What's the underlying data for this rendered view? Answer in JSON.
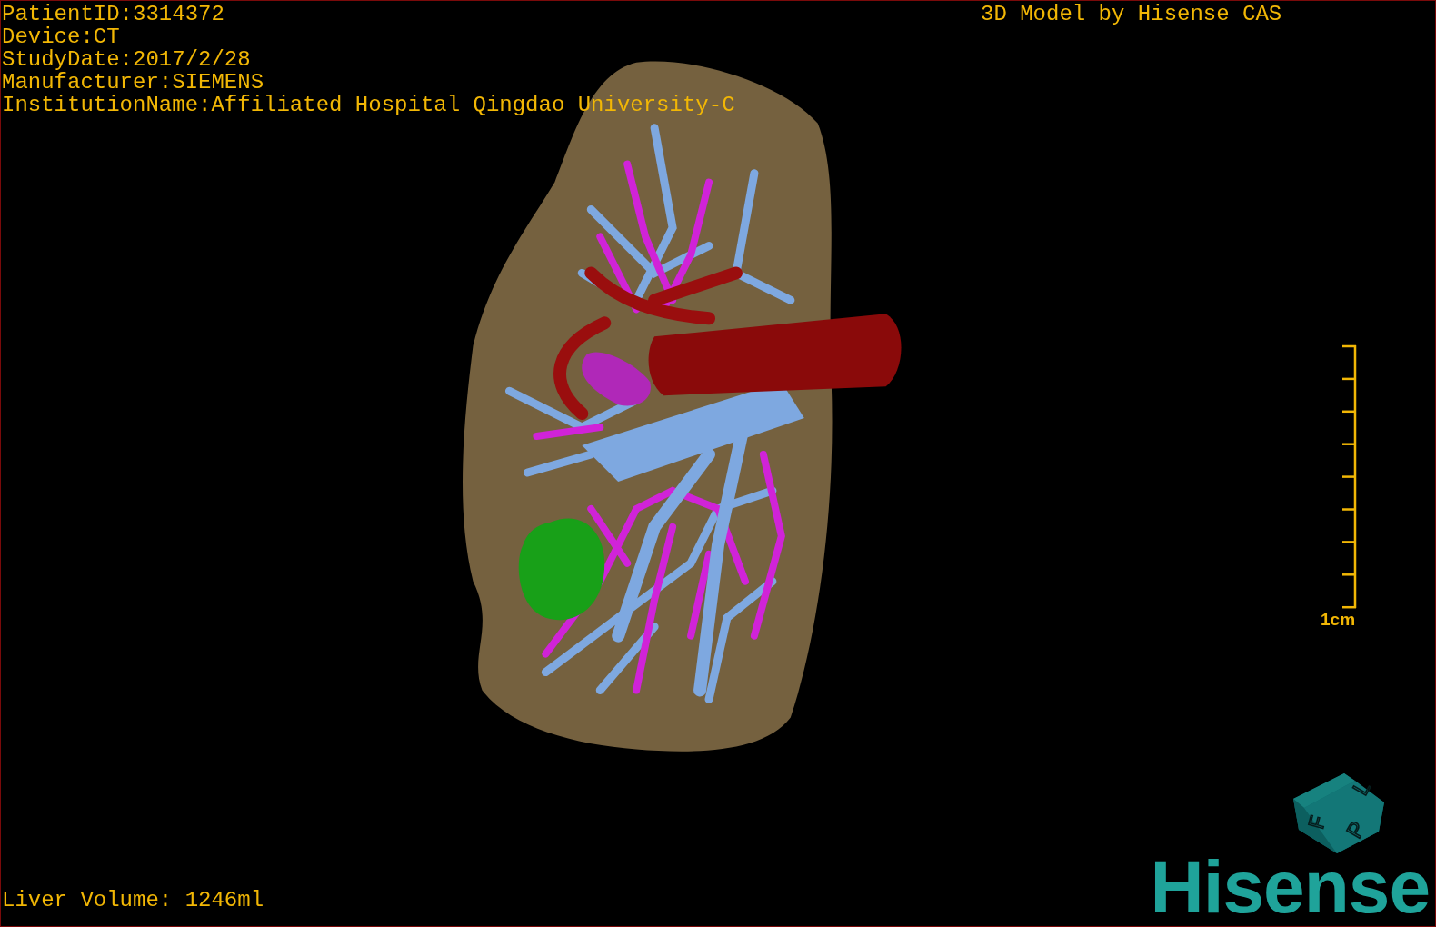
{
  "info_lines": [
    "PatientID:3314372",
    "Device:CT",
    "StudyDate:2017/2/28",
    "Manufacturer:SIEMENS",
    "InstitutionName:Affiliated Hospital Qingdao University-C"
  ],
  "credit": "3D Model by Hisense CAS",
  "scale_bar": {
    "label": "1cm"
  },
  "orientation_cube": {
    "faces": [
      "F",
      "L",
      "P"
    ]
  },
  "logo": "Hisense",
  "volume": "Liver Volume: 1246ml"
}
